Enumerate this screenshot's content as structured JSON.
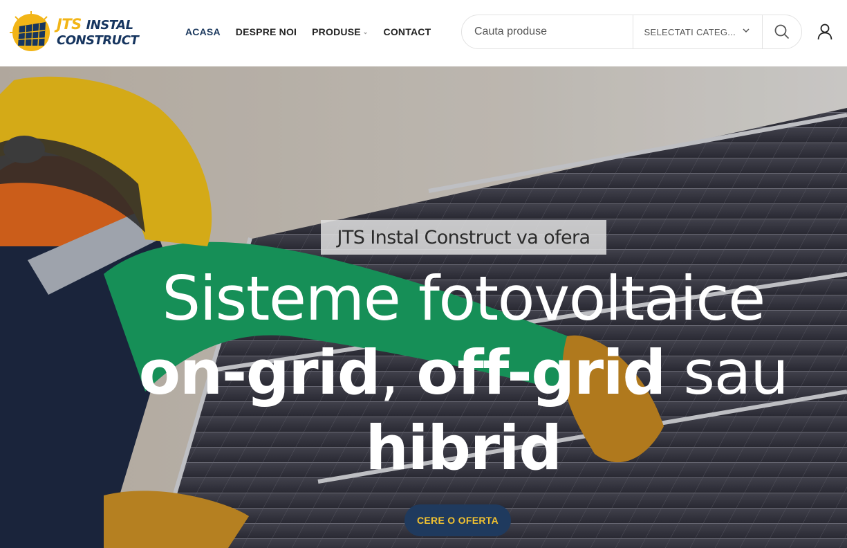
{
  "brand": {
    "logo_line1_a": "JTS",
    "logo_line1_b": "INSTAL",
    "logo_line2": "CONSTRUCT",
    "colors": {
      "navy": "#16355f",
      "gold": "#f2b517"
    }
  },
  "nav": {
    "items": [
      {
        "label": "ACASA",
        "active": true
      },
      {
        "label": "DESPRE NOI"
      },
      {
        "label": "PRODUSE",
        "has_dropdown": true
      },
      {
        "label": "CONTACT"
      }
    ]
  },
  "search": {
    "placeholder": "Cauta produse",
    "category_label": "SELECTATI CATEG...",
    "icons": {
      "submit": "search-icon",
      "category": "chevron-down-icon"
    }
  },
  "account": {
    "icon": "user-icon"
  },
  "hero": {
    "kicker": "JTS Instal Construct va ofera",
    "headline_line1": "Sisteme fotovoltaice",
    "headline_line2_bold_a": "on-grid",
    "headline_line2_sep": ", ",
    "headline_line2_bold_b": "off-grid",
    "headline_line2_rest": " sau",
    "headline_line3": "hibrid",
    "cta_label": "CERE O OFERTA",
    "colors": {
      "cta_bg": "#1f3a5e",
      "cta_text": "#f2c230"
    }
  }
}
